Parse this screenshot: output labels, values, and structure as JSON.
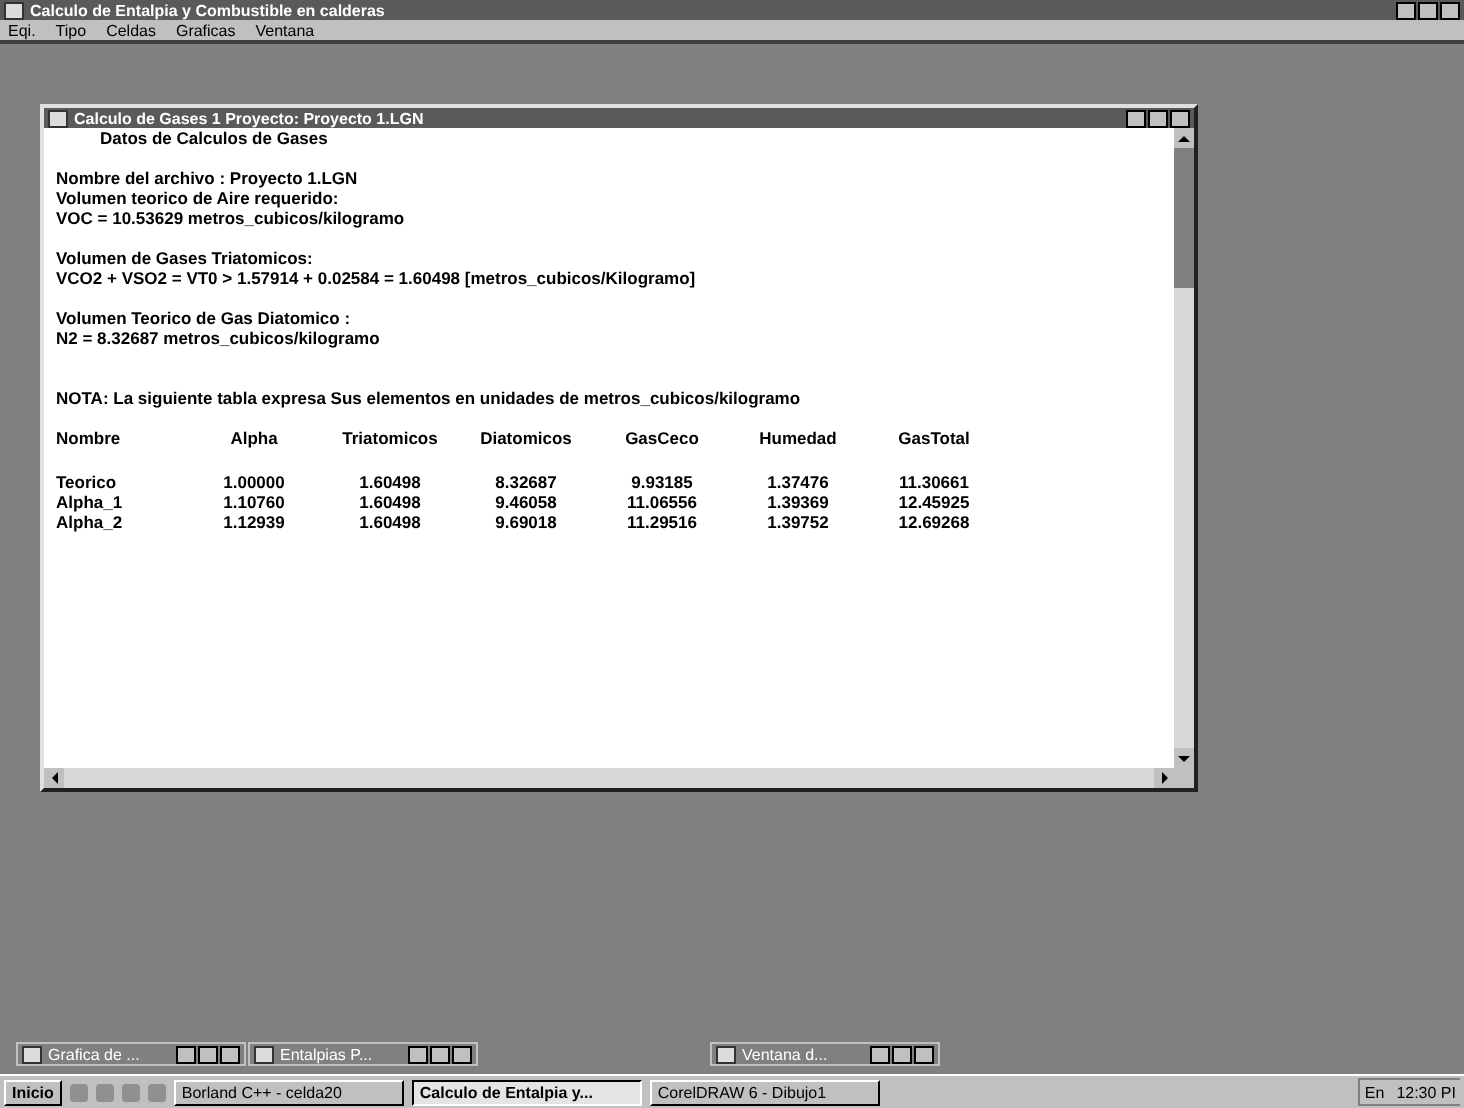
{
  "window": {
    "title": "Calculo de Entalpia y Combustible en calderas"
  },
  "menu": [
    "Eqi.",
    "Tipo",
    "Celdas",
    "Graficas",
    "Ventana"
  ],
  "child": {
    "title": "Calculo de Gases 1 Proyecto: Proyecto 1.LGN",
    "heading": "Datos de Calculos de Gases",
    "lines": [
      {
        "kind": "gap"
      },
      {
        "kind": "text",
        "text": "Nombre del archivo :  Proyecto 1.LGN"
      },
      {
        "kind": "text",
        "text": "Volumen teorico de Aire requerido:"
      },
      {
        "kind": "text",
        "text": "VOC =  10.53629  metros_cubicos/kilogramo"
      },
      {
        "kind": "gap"
      },
      {
        "kind": "text",
        "text": "Volumen de Gases Triatomicos:"
      },
      {
        "kind": "text",
        "text": "VCO2 + VSO2 = VT0  >  1.57914  + 0.02584  =  1.60498 [metros_cubicos/Kilogramo]"
      },
      {
        "kind": "gap"
      },
      {
        "kind": "text",
        "text": "Volumen Teorico de Gas Diatomico :"
      },
      {
        "kind": "text",
        "text": "N2 =  8.32687  metros_cubicos/kilogramo"
      },
      {
        "kind": "gap"
      },
      {
        "kind": "gap"
      },
      {
        "kind": "text",
        "text": "NOTA: La siguiente tabla expresa Sus elementos en unidades de metros_cubicos/kilogramo"
      }
    ],
    "table": {
      "columns": [
        "Nombre",
        "Alpha",
        "Triatomicos",
        "Diatomicos",
        "GasCeco",
        "Humedad",
        "GasTotal"
      ],
      "rows": [
        [
          "Teorico",
          "1.00000",
          "1.60498",
          "8.32687",
          "9.93185",
          "1.37476",
          "11.30661"
        ],
        [
          "Alpha_1",
          "1.10760",
          "1.60498",
          "9.46058",
          "11.06556",
          "1.39369",
          "12.45925"
        ],
        [
          "Alpha_2",
          "1.12939",
          "1.60498",
          "9.69018",
          "11.29516",
          "1.39752",
          "12.69268"
        ]
      ]
    }
  },
  "minimized": [
    "Grafica de ...",
    "Entalpias P...",
    "Ventana d..."
  ],
  "taskbar": {
    "start": "Inicio",
    "tasks": [
      {
        "label": "Borland C++ - celda20",
        "selected": false
      },
      {
        "label": "Calculo de Entalpia y...",
        "selected": true
      },
      {
        "label": "CorelDRAW 6 - Dibujo1",
        "selected": false
      }
    ],
    "lang": "En",
    "clock": "12:30 PI"
  }
}
